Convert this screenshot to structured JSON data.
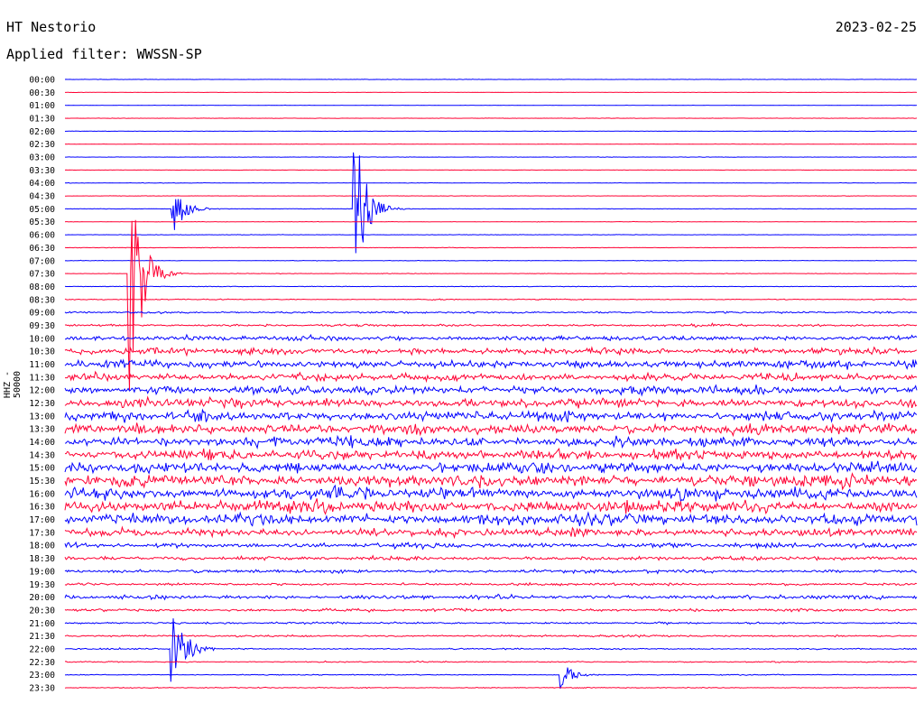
{
  "header": {
    "station": "HT Nestorio",
    "date": "2023-02-25",
    "filter_text": "Applied filter: WWSSN-SP",
    "channel_label": "HHZ - 50000"
  },
  "colors": {
    "trace_a": "#0000ff",
    "trace_b": "#ff0033",
    "background": "#ffffff"
  },
  "chart_data": {
    "type": "line",
    "title": "HT Nestorio",
    "ylabel": "HHZ - 50000",
    "row_labels": [
      "00:00",
      "00:30",
      "01:00",
      "01:30",
      "02:00",
      "02:30",
      "03:00",
      "03:30",
      "04:00",
      "04:30",
      "05:00",
      "05:30",
      "06:00",
      "06:30",
      "07:00",
      "07:30",
      "08:00",
      "08:30",
      "09:00",
      "09:30",
      "10:00",
      "10:30",
      "11:00",
      "11:30",
      "12:00",
      "12:30",
      "13:00",
      "13:30",
      "14:00",
      "14:30",
      "15:00",
      "15:30",
      "16:00",
      "16:30",
      "17:00",
      "17:30",
      "18:00",
      "18:30",
      "19:00",
      "19:30",
      "20:00",
      "20:30",
      "21:00",
      "21:30",
      "22:00",
      "22:30",
      "23:00",
      "23:30"
    ],
    "noise_level": [
      0.4,
      0.3,
      0.3,
      0.4,
      0.4,
      0.4,
      0.4,
      0.4,
      0.5,
      0.4,
      0.5,
      0.5,
      0.5,
      0.6,
      0.6,
      0.6,
      0.7,
      1.0,
      2.0,
      2.5,
      5,
      7,
      8,
      8,
      9,
      10,
      10,
      11,
      10,
      10,
      11,
      12,
      12,
      12,
      12,
      8,
      5,
      4,
      3.5,
      2.5,
      4,
      3,
      2,
      2,
      1.5,
      1.2,
      1,
      1
    ],
    "events": [
      {
        "row": "07:30",
        "x_fraction": 0.075,
        "amplitude": 170
      },
      {
        "row": "05:00",
        "x_fraction": 0.127,
        "amplitude": 30
      },
      {
        "row": "05:00",
        "x_fraction": 0.34,
        "amplitude": 100
      },
      {
        "row": "22:00",
        "x_fraction": 0.125,
        "amplitude": 70
      },
      {
        "row": "23:00",
        "x_fraction": 0.582,
        "amplitude": 18
      }
    ],
    "grid": false
  }
}
